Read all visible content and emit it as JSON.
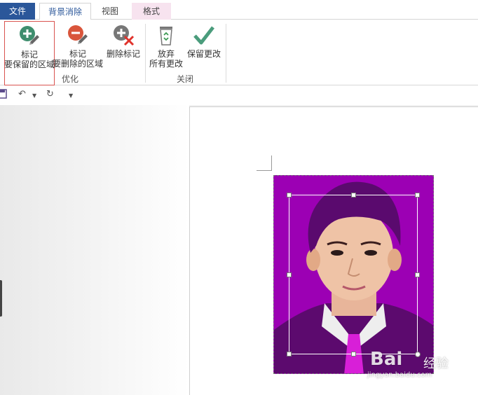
{
  "tabs": {
    "file": "文件",
    "background_removal": "背景消除",
    "view": "视图",
    "format": "格式"
  },
  "ribbon": {
    "mark_keep": {
      "line1": "标记",
      "line2": "要保留的区域",
      "icon": "plus-pencil-icon"
    },
    "mark_remove": {
      "line1": "标记",
      "line2": "要删除的区域",
      "icon": "minus-pencil-icon"
    },
    "delete_mark": {
      "line1": "删除标记",
      "icon": "delete-mark-icon"
    },
    "discard": {
      "line1": "放弃",
      "line2": "所有更改",
      "icon": "recycle-bin-icon"
    },
    "keep_changes": {
      "line1": "保留更改",
      "icon": "check-icon"
    },
    "group_optimize": "优化",
    "group_close": "关闭"
  },
  "qat": {
    "save_icon": "save-icon",
    "undo_icon": "undo-icon",
    "redo_icon": "redo-icon",
    "customize_icon": "customize-icon"
  },
  "watermark": {
    "brand": "Bai",
    "brand_suffix": "经验",
    "sub": "jingyan.baidu.com"
  },
  "colors": {
    "accent": "#2b579a",
    "photo_background": "#9c00b4",
    "format_tab": "#f7e3ef",
    "highlight_border": "#d9534f"
  }
}
